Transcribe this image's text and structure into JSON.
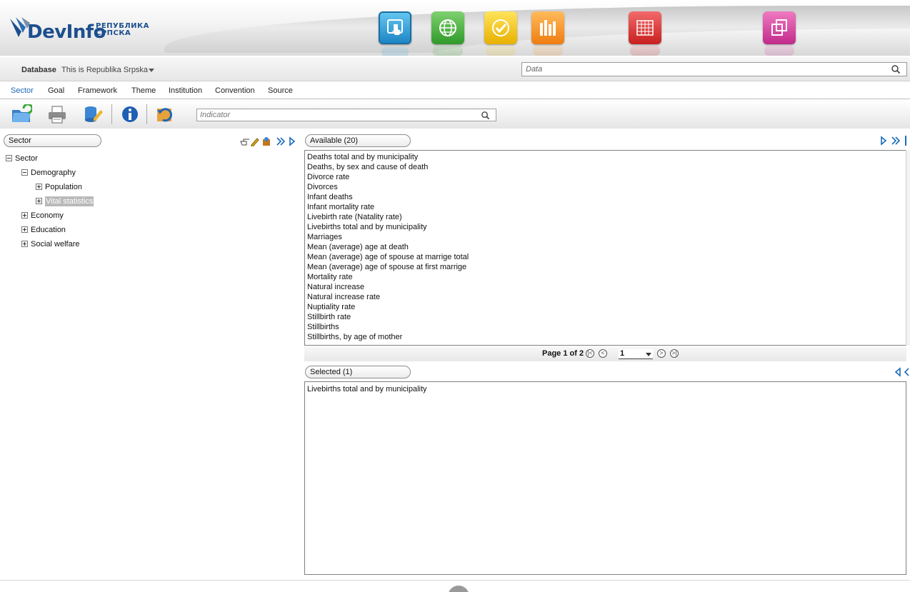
{
  "header": {
    "brand": "DevInfo",
    "brand_sub_line1": "РЕПУБЛИКА",
    "brand_sub_line2": "СРПСКА",
    "nav_icons": [
      {
        "name": "touch-icon",
        "color": "#2e9fd8"
      },
      {
        "name": "globe-icon",
        "color": "#3fae3a"
      },
      {
        "name": "check-icon",
        "color": "#f0c010"
      },
      {
        "name": "bar-chart-icon",
        "color": "#f39225"
      },
      {
        "name": "table-icon",
        "color": "#e13b3b"
      },
      {
        "name": "copy-pages-icon",
        "color": "#d640a0"
      }
    ]
  },
  "database": {
    "label": "Database",
    "value": "This is Republika Srpska",
    "search_placeholder": "Data"
  },
  "tabs": [
    "Sector",
    "Goal",
    "Framework",
    "Theme",
    "Institution",
    "Convention",
    "Source"
  ],
  "active_tab": "Sector",
  "toolbar": {
    "tools": [
      "open-folder-icon",
      "print-icon",
      "database-edit-icon",
      "info-icon",
      "refresh-icon"
    ],
    "indicator_placeholder": "Indicator"
  },
  "left_panel": {
    "header": "Sector",
    "tree": {
      "root": "Sector",
      "demography": "Demography",
      "population": "Population",
      "vital_statistics": "Vital statistics",
      "economy": "Economy",
      "education": "Education",
      "social_welfare": "Social welfare"
    }
  },
  "available": {
    "header": "Available (20)",
    "items": [
      "Deaths total and by municipality",
      "Deaths, by sex and cause of death",
      "Divorce rate",
      "Divorces",
      "Infant deaths",
      "Infant mortality rate",
      "Livebirth rate (Natality rate)",
      "Livebirths total and by municipality",
      "Marriages",
      "Mean (average) age at death",
      "Mean (average) age of spouse at marrige total",
      "Mean (average) age of spouse at first marrige",
      "Mortality rate",
      "Natural increase",
      "Natural increase rate",
      "Nuptiality rate",
      "Stillbirth rate",
      "Stillbirths",
      "Stillbirths, by age of mother"
    ]
  },
  "pager": {
    "text": "Page 1 of 2",
    "current": "1"
  },
  "selected": {
    "header": "Selected (1)",
    "items": [
      "Livebirths total and by municipality"
    ]
  }
}
